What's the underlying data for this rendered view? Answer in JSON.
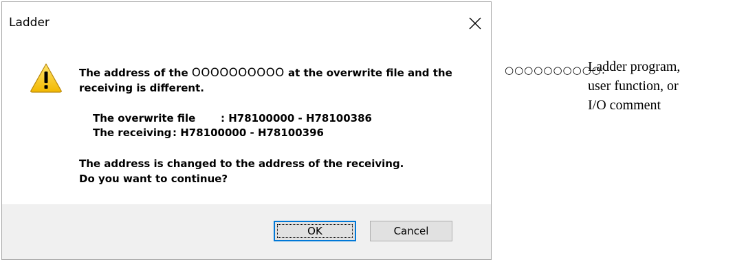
{
  "dialog": {
    "title": "Ladder",
    "message_prefix": "The address of the ",
    "placeholder": "OOOOOOOOOO",
    "message_suffix": " at the overwrite file and the receiving is different.",
    "overwrite_label": "The overwrite file",
    "overwrite_value": ": H78100000 - H78100386",
    "receiving_label": "The receiving",
    "receiving_value": ": H78100000 - H78100396",
    "changed_line": "The address is changed to the address of the receiving.",
    "question_line": "Do you want to continue?",
    "ok_label": "OK",
    "cancel_label": "Cancel",
    "icons": {
      "close": "close-icon",
      "warning": "warning-icon"
    }
  },
  "note": {
    "key": "○○○○○○○○○○:",
    "lines": [
      "Ladder program,",
      "user function, or",
      "I/O comment"
    ]
  }
}
